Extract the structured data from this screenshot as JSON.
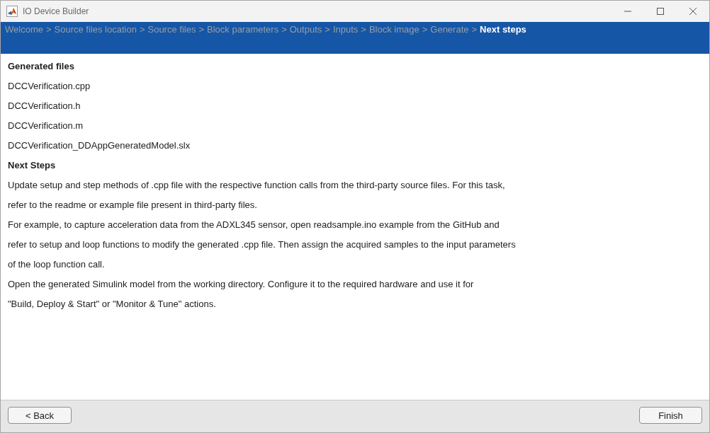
{
  "window": {
    "title": "IO Device Builder"
  },
  "breadcrumb": [
    {
      "label": "Welcome",
      "selected": false,
      "separator": ">"
    },
    {
      "label": "Source files location",
      "selected": false,
      "separator": ">"
    },
    {
      "label": "Source files",
      "selected": false,
      "separator": ">"
    },
    {
      "label": "Block parameters",
      "selected": false,
      "separator": ">"
    },
    {
      "label": "Outputs",
      "selected": false,
      "separator": ">"
    },
    {
      "label": "Inputs",
      "selected": false,
      "separator": ">"
    },
    {
      "label": "Block image",
      "selected": false,
      "separator": ">"
    },
    {
      "label": "Generate",
      "selected": false,
      "separator": ">"
    },
    {
      "label": "Next steps",
      "selected": true
    }
  ],
  "generated_files": {
    "heading": "Generated files",
    "files": [
      "DCCVerification.cpp",
      "DCCVerification.h",
      "DCCVerification.m",
      "DCCVerification_DDAppGeneratedModel.slx"
    ]
  },
  "next_steps": {
    "heading": "Next Steps",
    "paragraphs": [
      {
        "lines": [
          "Update setup and step methods of .cpp file with the respective function calls from the third-party source files. For this task,",
          "refer to the readme or example file present in third-party files."
        ]
      },
      {
        "lines": [
          "For example, to capture acceleration data from the ADXL345 sensor, open readsample.ino example from the GitHub and",
          "refer to setup and loop functions to modify the generated .cpp file. Then assign the acquired samples to the input parameters",
          "of the loop function call."
        ]
      },
      {
        "lines": [
          "Open the generated Simulink model from the working directory. Configure it to the required hardware and use it for",
          "\"Build, Deploy & Start\" or \"Monitor & Tune\" actions."
        ]
      }
    ]
  },
  "buttons": [
    {
      "label": "< Back",
      "kind": "back"
    },
    {
      "label": "Finish",
      "kind": "finish"
    }
  ]
}
